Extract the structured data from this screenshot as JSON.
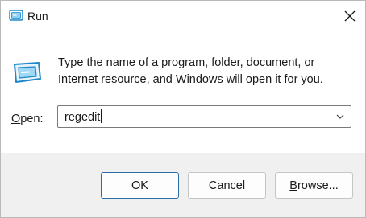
{
  "window": {
    "title": "Run",
    "title_icon": "run-app-icon",
    "close_icon": "close-icon"
  },
  "dialog": {
    "app_icon": "run-app-icon",
    "description": "Type the name of a program, folder, document, or Internet resource, and Windows will open it for you.",
    "open_label_accel": "O",
    "open_label_rest": "pen:",
    "open_value": "regedit",
    "dropdown_icon": "chevron-down-icon"
  },
  "buttons": {
    "ok_label": "OK",
    "cancel_label": "Cancel",
    "browse_accel": "B",
    "browse_rest": "rowse..."
  },
  "colors": {
    "accent_border": "#2b6ca8",
    "footer_bg": "#f0f0f0",
    "icon_blue": "#1e88c8"
  }
}
